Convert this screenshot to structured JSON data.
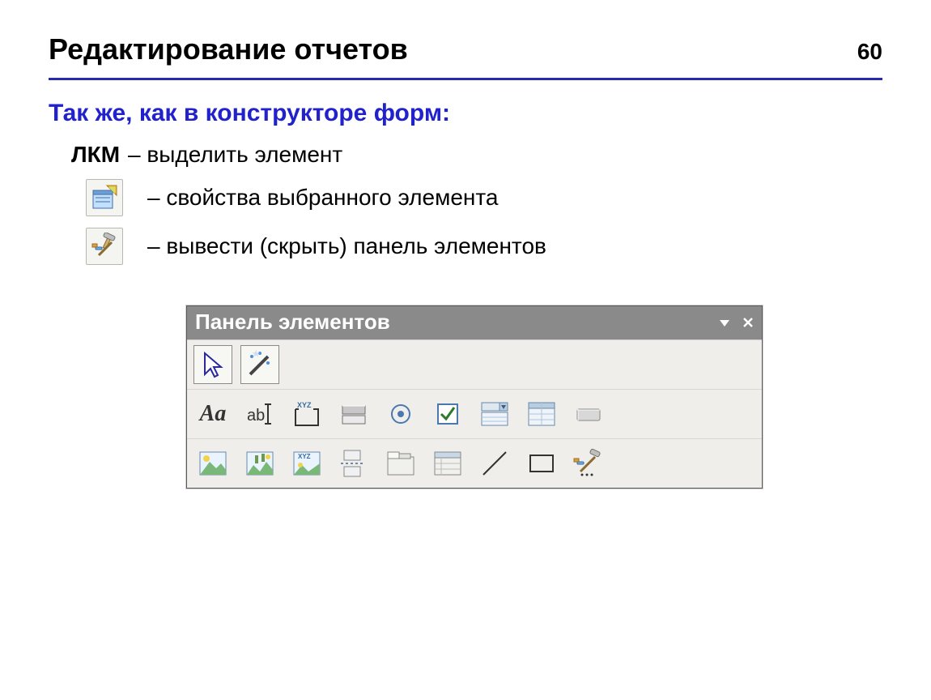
{
  "page_number": "60",
  "title": "Редактирование отчетов",
  "subtitle": "Так же, как в конструкторе форм:",
  "lmb_label": "ЛКМ",
  "lmb_desc": "– выделить  элемент",
  "prop_desc": "– свойства выбранного элемента",
  "tools_desc": "– вывести (скрыть) панель элементов",
  "toolbox": {
    "title": "Панель элементов",
    "icons": {
      "select": "pointer-icon",
      "wizard": "wizard-icon",
      "label": "label-icon",
      "textbox": "textbox-icon",
      "group": "group-box-icon",
      "toggle": "toggle-button-icon",
      "option": "option-button-icon",
      "checkbox": "checkbox-icon",
      "combo": "combo-box-icon",
      "list": "list-box-icon",
      "button": "command-button-icon",
      "image": "image-icon",
      "unbound": "unbound-frame-icon",
      "bound": "bound-frame-icon",
      "pagebreak": "page-break-icon",
      "tab": "tab-control-icon",
      "subform": "subform-icon",
      "line": "line-icon",
      "rect": "rectangle-icon",
      "more": "more-tools-icon"
    }
  }
}
